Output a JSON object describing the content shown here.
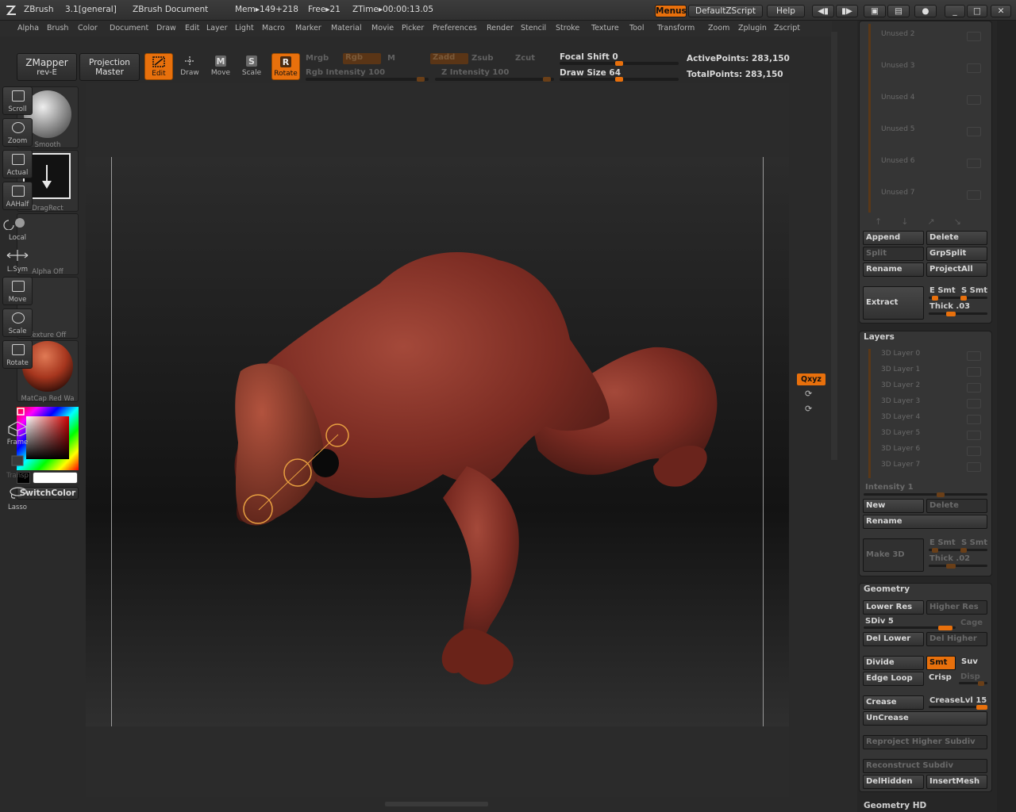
{
  "titlebar": {
    "app": "ZBrush",
    "version": "3.1[general]",
    "document": "ZBrush Document",
    "mem": "Mem▸149+218",
    "free": "Free▸21",
    "ztime": "ZTime▸00:00:13.05",
    "menus_btn": "Menus",
    "script_btn": "DefaultZScript",
    "help_btn": "Help"
  },
  "menubar": {
    "items": [
      "Alpha",
      "Brush",
      "Color",
      "Document",
      "Draw",
      "Edit",
      "Layer",
      "Light",
      "Macro",
      "Marker",
      "Material",
      "Movie",
      "Picker",
      "Preferences",
      "Render",
      "Stencil",
      "Stroke",
      "Texture",
      "Tool",
      "Transform",
      "Zoom",
      "Zplugin",
      "Zscript"
    ]
  },
  "toolbar": {
    "zmapper": "ZMapper",
    "zmapper_sub": "rev-E",
    "projection": "Projection",
    "projection_sub": "Master",
    "edit": "Edit",
    "draw": "Draw",
    "move": "Move",
    "scale": "Scale",
    "rotate": "Rotate",
    "mrgb": "Mrgb",
    "rgb": "Rgb",
    "m": "M",
    "zadd": "Zadd",
    "zsub": "Zsub",
    "zcut": "Zcut",
    "rgb_intensity": "Rgb Intensity 100",
    "z_intensity": "Z Intensity 100",
    "focal_shift": "Focal Shift 0",
    "draw_size": "Draw Size 64",
    "active_points": "ActivePoints: 283,150",
    "total_points": "TotalPoints: 283,150"
  },
  "leftshelf": {
    "brush": "Smooth",
    "stroke": "DragRect",
    "alpha": "Alpha Off",
    "texture": "Texture Off",
    "material": "MatCap Red Wa",
    "switchcolor": "SwitchColor"
  },
  "rightshelf": {
    "scroll": "Scroll",
    "zoom": "Zoom",
    "actual": "Actual",
    "aahalf": "AAHalf",
    "local": "Local",
    "lsym": "L.Sym",
    "move": "Move",
    "scale": "Scale",
    "rotate": "Rotate",
    "xyz": "Qxyz",
    "frame": "Frame",
    "transp": "Transp",
    "lasso": "Lasso"
  },
  "subtool": {
    "unused": [
      "Unused 2",
      "Unused 3",
      "Unused 4",
      "Unused 5",
      "Unused 6",
      "Unused 7"
    ],
    "append": "Append",
    "delete": "Delete",
    "split": "Split",
    "grpsplit": "GrpSplit",
    "rename": "Rename",
    "projectall": "ProjectAll",
    "extract": "Extract",
    "esmt": "E Smt",
    "ssmt": "S Smt",
    "thick": "Thick .03"
  },
  "layers": {
    "title": "Layers",
    "items": [
      "3D Layer 0",
      "3D Layer 1",
      "3D Layer 2",
      "3D Layer 3",
      "3D Layer 4",
      "3D Layer 5",
      "3D Layer 6",
      "3D Layer 7"
    ],
    "intensity": "Intensity 1",
    "new": "New",
    "delete": "Delete",
    "rename": "Rename",
    "make3d": "Make 3D",
    "esmt": "E Smt",
    "ssmt": "S Smt",
    "thick": "Thick .02"
  },
  "geometry": {
    "title": "Geometry",
    "lower_res": "Lower Res",
    "higher_res": "Higher Res",
    "sdiv": "SDiv 5",
    "cage": "Cage",
    "del_lower": "Del Lower",
    "del_higher": "Del Higher",
    "divide": "Divide",
    "smt": "Smt",
    "suv": "Suv",
    "edge_loop": "Edge Loop",
    "crisp": "Crisp",
    "disp": "Disp",
    "crease": "Crease",
    "creaselvl": "CreaseLvl 15",
    "uncrease": "UnCrease",
    "reproject": "Reproject Higher Subdiv",
    "reconstruct": "Reconstruct Subdiv",
    "delhidden": "DelHidden",
    "insertmesh": "InsertMesh",
    "geometry_hd": "Geometry HD"
  },
  "colors": {
    "accent": "#e8700c",
    "model": "#7a2b22"
  }
}
